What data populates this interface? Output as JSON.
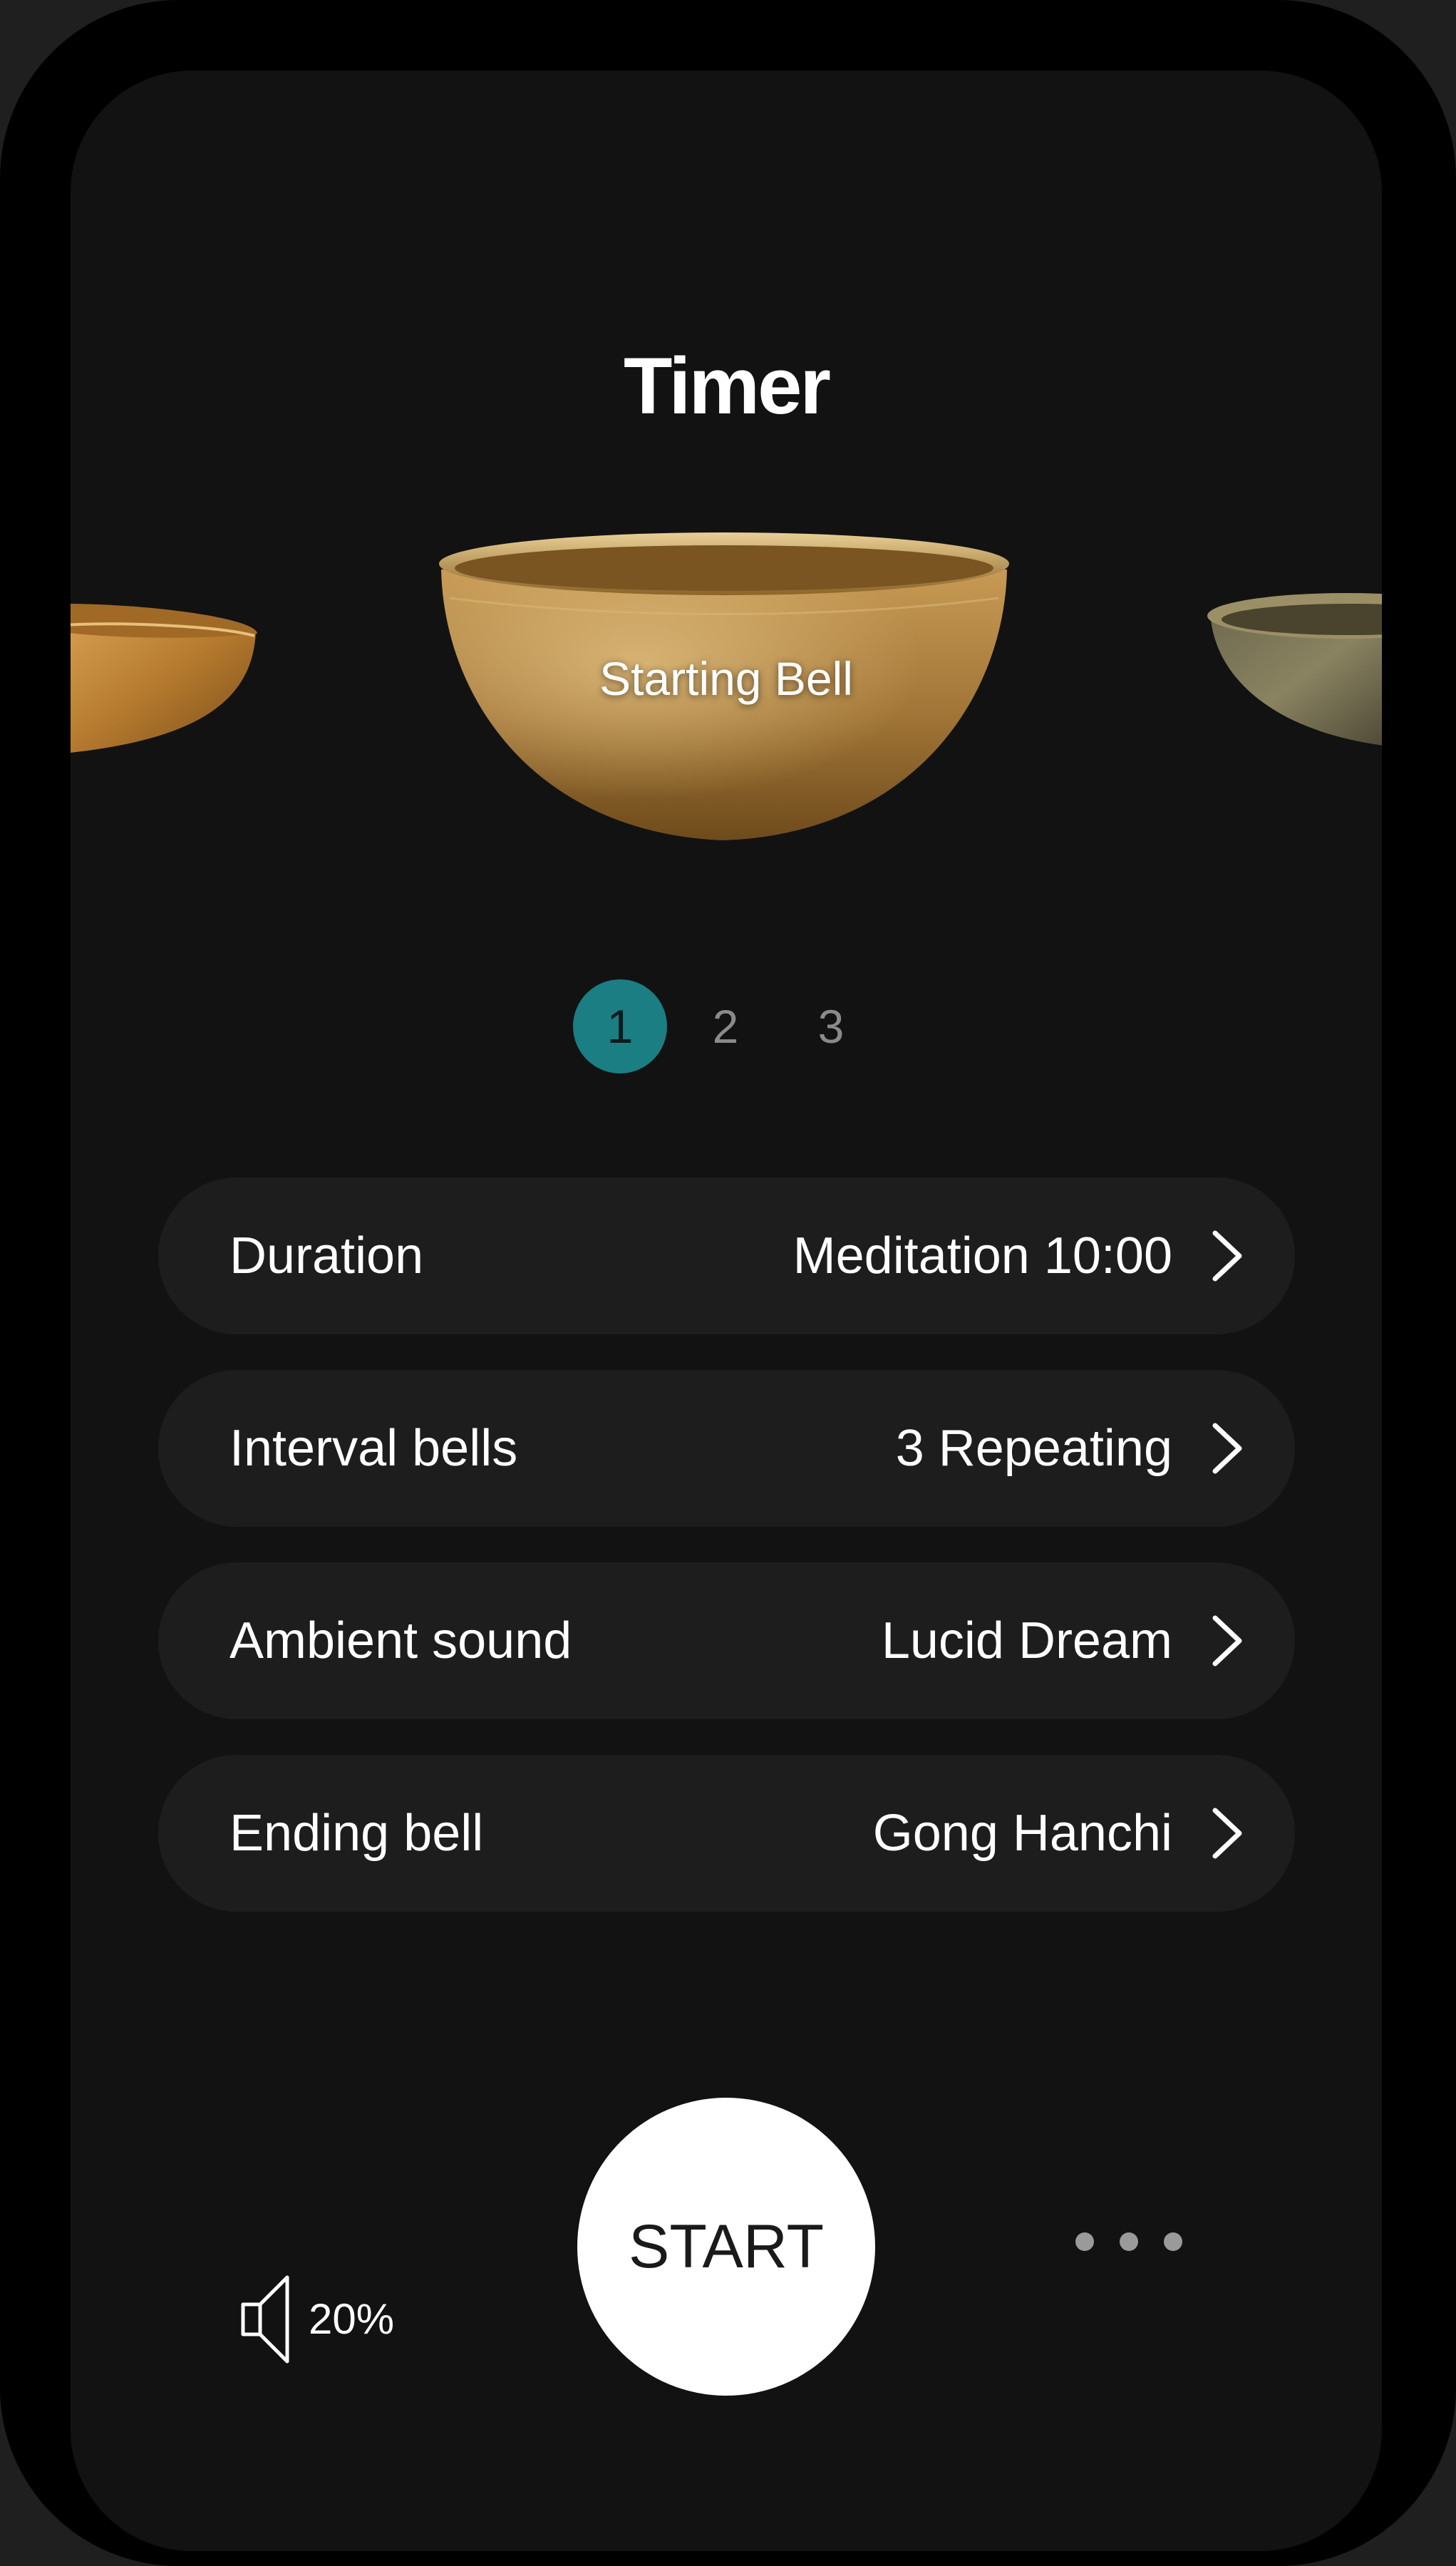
{
  "header": {
    "title": "Timer"
  },
  "carousel": {
    "current_label": "Starting Bell",
    "pages": [
      "1",
      "2",
      "3"
    ],
    "active_page": 1
  },
  "settings": [
    {
      "label": "Duration",
      "value": "Meditation 10:00"
    },
    {
      "label": "Interval bells",
      "value": "3 Repeating"
    },
    {
      "label": "Ambient sound",
      "value": "Lucid Dream"
    },
    {
      "label": "Ending bell",
      "value": "Gong Hanchi"
    }
  ],
  "controls": {
    "volume": "20%",
    "start_label": "START",
    "volume_icon": "speaker-icon",
    "more_icon": "more-horizontal-icon"
  },
  "colors": {
    "accent": "#1a7e82",
    "background": "#121212",
    "row_background": "#1d1d1d"
  }
}
